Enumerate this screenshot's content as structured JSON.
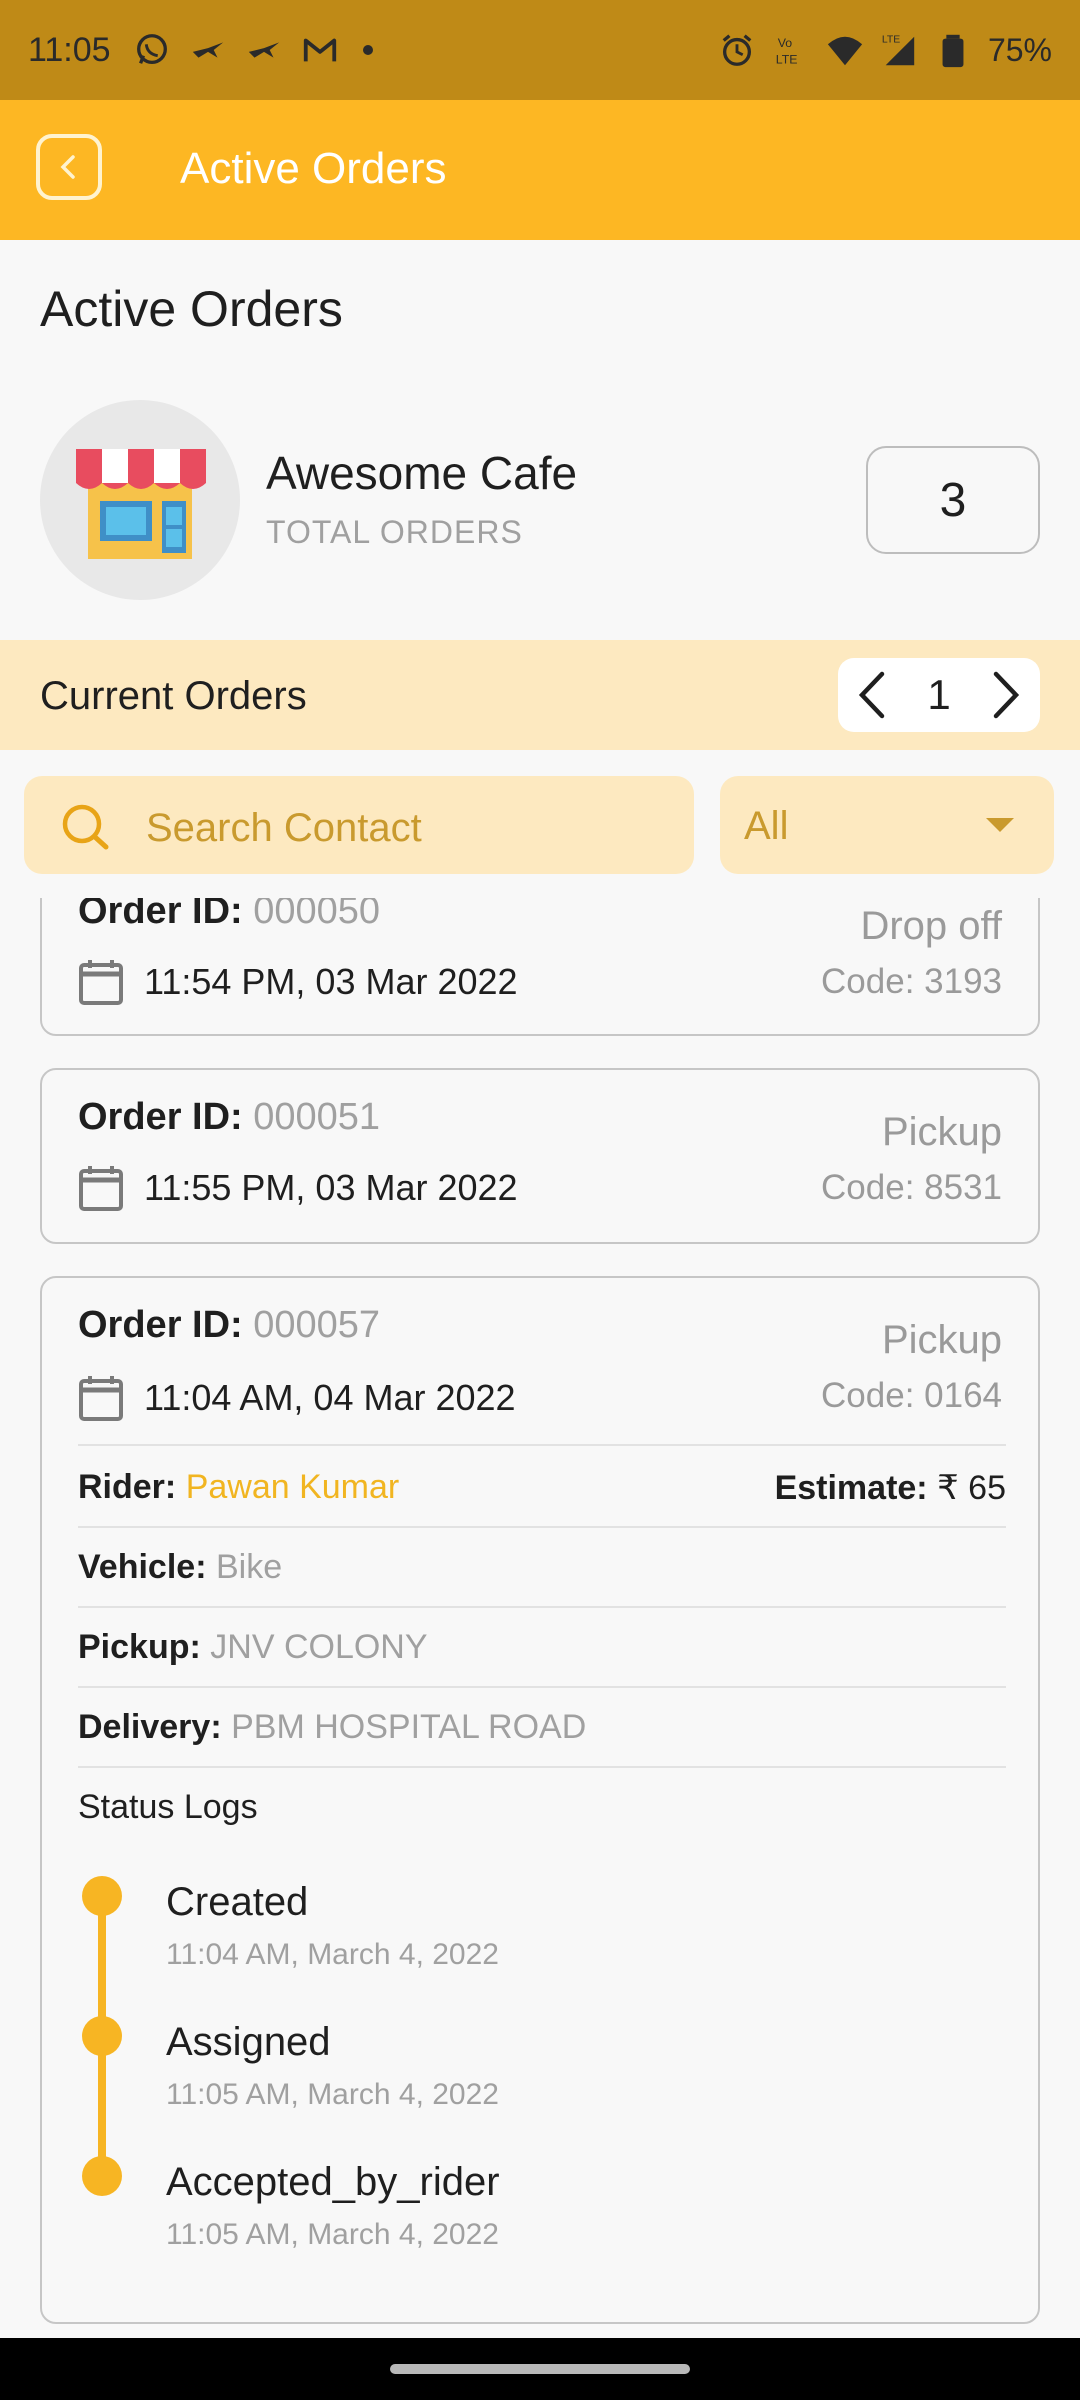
{
  "status_bar": {
    "time": "11:05",
    "battery": "75%",
    "icons_left": [
      "whatsapp-icon",
      "bird-icon",
      "bird-icon",
      "gmail-icon",
      "dot-icon"
    ],
    "icons_right": [
      "alarm-icon",
      "volte-icon",
      "wifi-icon",
      "signal-icon",
      "battery-icon"
    ]
  },
  "app_bar": {
    "title": "Active Orders",
    "back_icon": "chevron-left-icon",
    "color": "#fdb723"
  },
  "header": {
    "heading": "Active Orders",
    "store_name": "Awesome Cafe",
    "total_orders_label": "TOTAL ORDERS",
    "total_orders_count": "3",
    "store_icon": "storefront-icon"
  },
  "current_orders": {
    "title": "Current Orders",
    "page": "1"
  },
  "search": {
    "placeholder": "Search Contact"
  },
  "filter": {
    "value": "All"
  },
  "orders": [
    {
      "id_label": "Order ID:",
      "id": "000050",
      "date": "11:54 PM, 03 Mar 2022",
      "type": "Drop off",
      "code": "Code: 3193"
    },
    {
      "id_label": "Order ID:",
      "id": "000051",
      "date": "11:55 PM, 03 Mar 2022",
      "type": "Pickup",
      "code": "Code: 8531"
    },
    {
      "id_label": "Order ID:",
      "id": "000057",
      "date": "11:04 AM, 04 Mar 2022",
      "type": "Pickup",
      "code": "Code: 0164",
      "rider_label": "Rider:",
      "rider": "Pawan Kumar",
      "estimate_label": "Estimate:",
      "estimate": "₹ 65",
      "vehicle_label": "Vehicle:",
      "vehicle": "Bike",
      "pickup_label": "Pickup:",
      "pickup": "JNV COLONY",
      "delivery_label": "Delivery:",
      "delivery": "PBM HOSPITAL ROAD",
      "status_logs_title": "Status Logs",
      "logs": [
        {
          "status": "Created",
          "time": "11:04 AM, March 4, 2022"
        },
        {
          "status": "Assigned",
          "time": "11:05 AM, March 4, 2022"
        },
        {
          "status": "Accepted_by_rider",
          "time": "11:05 AM, March 4, 2022"
        }
      ]
    }
  ]
}
